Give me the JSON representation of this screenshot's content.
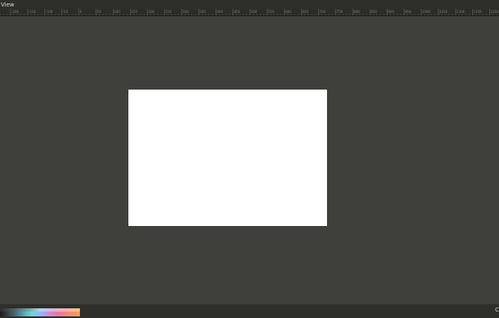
{
  "menubar": {
    "items": [
      {
        "label": "View"
      }
    ]
  },
  "ruler": {
    "labels": [
      "-200",
      "-150",
      "-100",
      "-50",
      "0",
      "50",
      "100",
      "150",
      "200",
      "250",
      "300",
      "350",
      "400",
      "450",
      "500",
      "550",
      "600",
      "650",
      "700",
      "750",
      "800",
      "850",
      "900",
      "950",
      "1000",
      "1050",
      "1100",
      "1150",
      "1200"
    ]
  },
  "statusbar": {
    "right_text": "C"
  },
  "colors": {
    "workspace_bg": "#3f3f3b",
    "page": "#ffffff",
    "menubar_bg": "#2e2e2b",
    "ruler_bg": "#2b2b28"
  }
}
